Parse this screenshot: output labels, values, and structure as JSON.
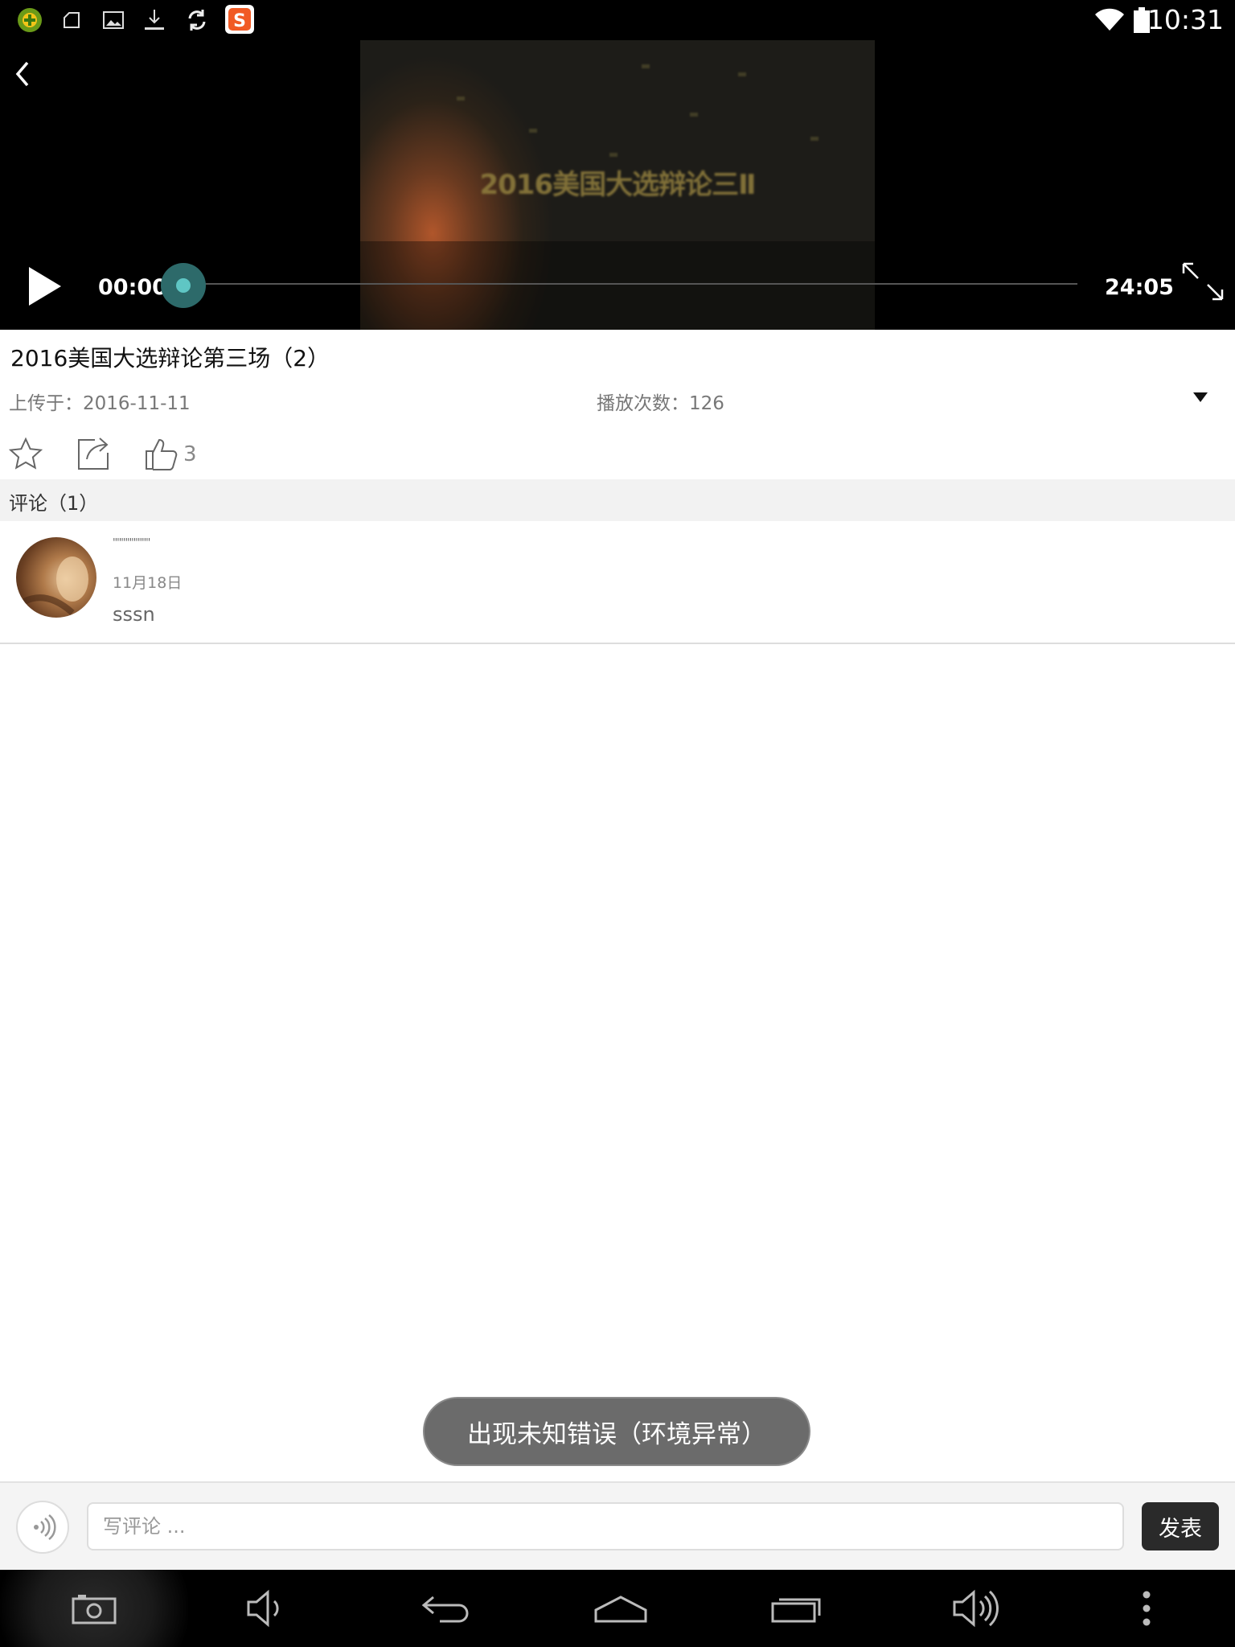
{
  "status_bar": {
    "time": "10:31",
    "left_icons": [
      "app-green-icon",
      "folder-icon",
      "image-icon",
      "download-icon",
      "sync-icon",
      "sogou-s-icon"
    ],
    "right_icons": [
      "wifi-icon",
      "battery-icon"
    ]
  },
  "player": {
    "frame_caption": "2016美国大选辩论三Ⅱ",
    "current_time": "00:00",
    "total_time": "24:05",
    "progress": 0,
    "accent_color": "#5fc6c4"
  },
  "video": {
    "title": "2016美国大选辩论第三场（2）",
    "uploaded": "上传于：2016-11-11",
    "plays": "播放次数：126",
    "likes": "3"
  },
  "comments": {
    "header": "评论（1）",
    "items": [
      {
        "name": "''''''''''''''''''",
        "date": "11月18日",
        "text": "sssn"
      }
    ]
  },
  "toast": {
    "message": "出现未知错误（环境异常）"
  },
  "composer": {
    "placeholder": "写评论 ...",
    "send_label": "发表"
  },
  "nav_icons": [
    "screenshot-icon",
    "volume-down-icon",
    "back-icon",
    "home-icon",
    "recents-icon",
    "volume-up-icon",
    "more-icon"
  ]
}
